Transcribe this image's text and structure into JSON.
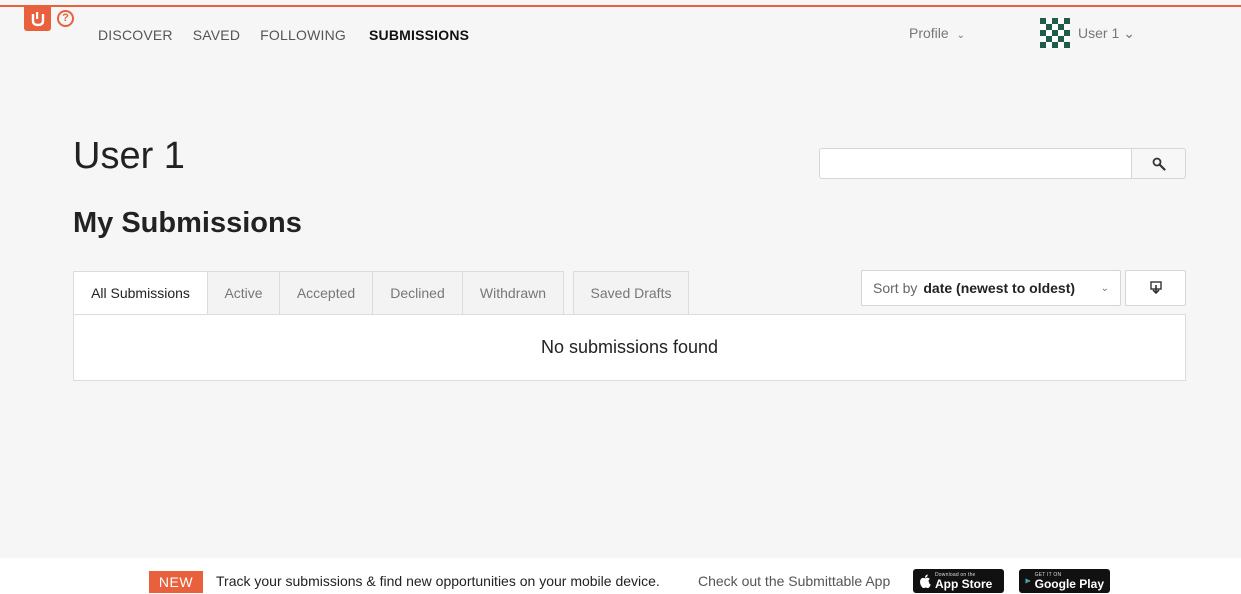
{
  "nav": {
    "items": [
      {
        "label": "DISCOVER"
      },
      {
        "label": "SAVED"
      },
      {
        "label": "FOLLOWING"
      },
      {
        "label": "SUBMISSIONS",
        "active": true
      }
    ],
    "profile_label": "Profile",
    "user_name": "User 1"
  },
  "header": {
    "title": "User 1",
    "search": {
      "value": "",
      "placeholder": ""
    }
  },
  "section": {
    "title": "My Submissions"
  },
  "tabs": [
    {
      "label": "All Submissions",
      "active": true
    },
    {
      "label": "Active"
    },
    {
      "label": "Accepted"
    },
    {
      "label": "Declined"
    },
    {
      "label": "Withdrawn"
    }
  ],
  "drafts_tab": {
    "label": "Saved Drafts"
  },
  "sort": {
    "prefix": "Sort by",
    "selected": "date (newest to oldest)"
  },
  "results": {
    "empty_message": "No submissions found"
  },
  "footer": {
    "badge": "NEW",
    "text": "Track your submissions & find new opportunities on your mobile device.",
    "cta": "Check out the Submittable App",
    "appstore_small": "Download on the",
    "appstore_big": "App Store",
    "googleplay_small": "GET IT ON",
    "googleplay_big": "Google Play"
  },
  "colors": {
    "accent": "#e8603c",
    "background": "#f6f6f6"
  },
  "icons": [
    "submittable-logo-icon",
    "help-icon",
    "chevron-down-icon",
    "avatar",
    "search-icon",
    "download-icon",
    "apple-icon",
    "google-play-icon"
  ]
}
